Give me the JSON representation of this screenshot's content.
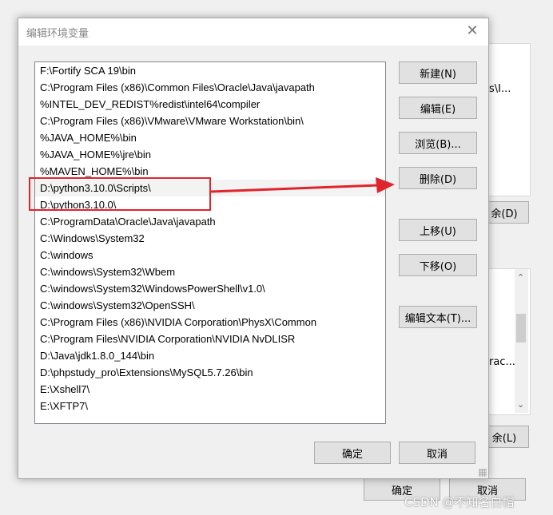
{
  "background_window": {
    "upper_truncated_text": "s\\I...",
    "upper_delete_button": "余(D)",
    "lower_truncated_text": "rac...",
    "lower_delete_button": "余(L)",
    "ok_button": "确定",
    "cancel_button": "取消"
  },
  "dialog": {
    "title": "编辑环境变量",
    "close_icon": "close-icon",
    "paths": [
      "F:\\Fortify SCA 19\\bin",
      "C:\\Program Files (x86)\\Common Files\\Oracle\\Java\\javapath",
      "%INTEL_DEV_REDIST%redist\\intel64\\compiler",
      "C:\\Program Files (x86)\\VMware\\VMware Workstation\\bin\\",
      "%JAVA_HOME%\\bin",
      "%JAVA_HOME%\\jre\\bin",
      "%MAVEN_HOME%\\bin",
      "D:\\python3.10.0\\Scripts\\",
      "D:\\python3.10.0\\",
      "C:\\ProgramData\\Oracle\\Java\\javapath",
      "C:\\Windows\\System32",
      "C:\\windows",
      "C:\\windows\\System32\\Wbem",
      "C:\\windows\\System32\\WindowsPowerShell\\v1.0\\",
      "C:\\windows\\System32\\OpenSSH\\",
      "C:\\Program Files (x86)\\NVIDIA Corporation\\PhysX\\Common",
      "C:\\Program Files\\NVIDIA Corporation\\NVIDIA NvDLISR",
      "D:\\Java\\jdk1.8.0_144\\bin",
      "D:\\phpstudy_pro\\Extensions\\MySQL5.7.26\\bin",
      "E:\\Xshell7\\",
      "E:\\XFTP7\\"
    ],
    "buttons": {
      "new": "新建(N)",
      "edit": "编辑(E)",
      "browse": "浏览(B)...",
      "delete": "删除(D)",
      "move_up": "上移(U)",
      "move_down": "下移(O)",
      "edit_text": "编辑文本(T)..."
    },
    "ok": "确定",
    "cancel": "取消"
  },
  "colors": {
    "annotation": "#e0242b"
  },
  "watermark": "CSDN @不知名白帽"
}
